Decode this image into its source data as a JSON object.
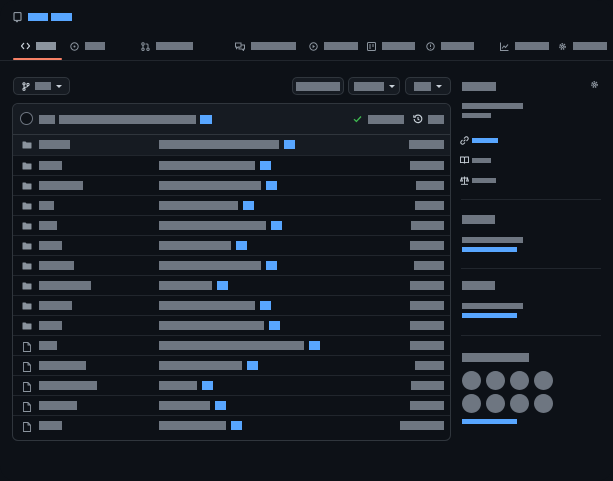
{
  "colors": {
    "background": "#0d1117",
    "surface": "#161b22",
    "border": "#30363d",
    "placeholder": "#6e7681",
    "link": "#58a6ff",
    "active_tab": "#f78166",
    "success": "#3fb950"
  },
  "header": {
    "icon": "repo-icon"
  },
  "tabs": [
    {
      "icon": "code-icon",
      "selected": true
    },
    {
      "icon": "issue-icon"
    },
    {
      "icon": "pull-request-icon"
    },
    {
      "icon": "discussion-icon"
    },
    {
      "icon": "actions-icon"
    },
    {
      "icon": "projects-icon"
    },
    {
      "icon": "security-icon"
    },
    {
      "icon": "insights-icon"
    },
    {
      "icon": "gear-icon"
    }
  ],
  "controls": {
    "branch": {
      "icon": "branch-icon",
      "dropdown": true
    },
    "buttons": [
      "go-to-file",
      "add-file-dropdown",
      "code-dropdown"
    ]
  },
  "commit_header": {
    "icons": [
      "avatar",
      "check-icon",
      "history-icon"
    ]
  },
  "files": [
    {
      "type": "folder"
    },
    {
      "type": "folder"
    },
    {
      "type": "folder"
    },
    {
      "type": "folder"
    },
    {
      "type": "folder"
    },
    {
      "type": "folder"
    },
    {
      "type": "folder"
    },
    {
      "type": "folder"
    },
    {
      "type": "folder"
    },
    {
      "type": "folder"
    },
    {
      "type": "file"
    },
    {
      "type": "file"
    },
    {
      "type": "file"
    },
    {
      "type": "file"
    },
    {
      "type": "file"
    }
  ],
  "sidebar": {
    "about_icons": [
      "link-icon",
      "book-icon",
      "law-icon"
    ],
    "settings_icon": "gear-icon",
    "contributors_avatar_count": 8
  }
}
